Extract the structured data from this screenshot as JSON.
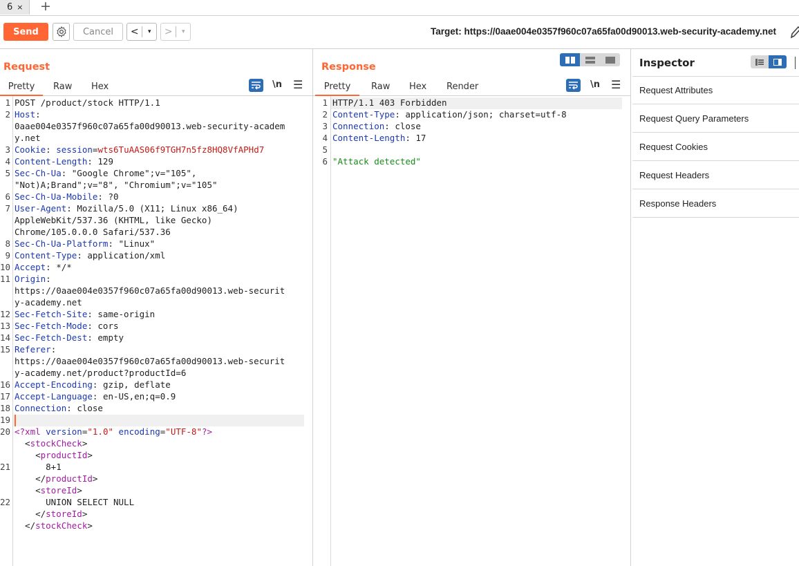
{
  "tab": {
    "label": "6",
    "close": "×",
    "new": "+"
  },
  "toolbar": {
    "send_label": "Send",
    "cancel_label": "Cancel",
    "back": "<",
    "forward": ">",
    "dropdown": "▾",
    "target_label": "Target: https://0aae004e0357f960c07a65fa00d90013.web-security-academy.net"
  },
  "request": {
    "title": "Request",
    "tabs": [
      "Pretty",
      "Raw",
      "Hex"
    ],
    "newline_label": "\\n",
    "lines": [
      {
        "n": "1",
        "segs": [
          {
            "t": "POST /product/stock HTTP/1.1",
            "c": ""
          }
        ]
      },
      {
        "n": "2",
        "segs": [
          {
            "t": "Host",
            "c": "hk"
          },
          {
            "t": ":",
            "c": ""
          }
        ]
      },
      {
        "n": "",
        "segs": [
          {
            "t": "0aae004e0357f960c07a65fa00d90013.web-security-academ",
            "c": ""
          }
        ]
      },
      {
        "n": "",
        "segs": [
          {
            "t": "y.net",
            "c": ""
          }
        ]
      },
      {
        "n": "3",
        "segs": [
          {
            "t": "Cookie",
            "c": "hk"
          },
          {
            "t": ": ",
            "c": ""
          },
          {
            "t": "session",
            "c": "hk"
          },
          {
            "t": "=",
            "c": ""
          },
          {
            "t": "wts6TuAAS06f9TGH7n5fz8HQ8VfAPHd7",
            "c": "cookie"
          }
        ]
      },
      {
        "n": "4",
        "segs": [
          {
            "t": "Content-Length",
            "c": "hk"
          },
          {
            "t": ": 129",
            "c": ""
          }
        ]
      },
      {
        "n": "5",
        "segs": [
          {
            "t": "Sec-Ch-Ua",
            "c": "hk"
          },
          {
            "t": ": \"Google Chrome\";v=\"105\",",
            "c": ""
          }
        ]
      },
      {
        "n": "",
        "segs": [
          {
            "t": "\"Not)A;Brand\";v=\"8\", \"Chromium\";v=\"105\"",
            "c": ""
          }
        ]
      },
      {
        "n": "6",
        "segs": [
          {
            "t": "Sec-Ch-Ua-Mobile",
            "c": "hk"
          },
          {
            "t": ": ?0",
            "c": ""
          }
        ]
      },
      {
        "n": "7",
        "segs": [
          {
            "t": "User-Agent",
            "c": "hk"
          },
          {
            "t": ": Mozilla/5.0 (X11; Linux x86_64)",
            "c": ""
          }
        ]
      },
      {
        "n": "",
        "segs": [
          {
            "t": "AppleWebKit/537.36 (KHTML, like Gecko)",
            "c": ""
          }
        ]
      },
      {
        "n": "",
        "segs": [
          {
            "t": "Chrome/105.0.0.0 Safari/537.36",
            "c": ""
          }
        ]
      },
      {
        "n": "8",
        "segs": [
          {
            "t": "Sec-Ch-Ua-Platform",
            "c": "hk"
          },
          {
            "t": ": \"Linux\"",
            "c": ""
          }
        ]
      },
      {
        "n": "9",
        "segs": [
          {
            "t": "Content-Type",
            "c": "hk"
          },
          {
            "t": ": application/xml",
            "c": ""
          }
        ]
      },
      {
        "n": "10",
        "segs": [
          {
            "t": "Accept",
            "c": "hk"
          },
          {
            "t": ": */*",
            "c": ""
          }
        ]
      },
      {
        "n": "11",
        "segs": [
          {
            "t": "Origin",
            "c": "hk"
          },
          {
            "t": ":",
            "c": ""
          }
        ]
      },
      {
        "n": "",
        "segs": [
          {
            "t": "https://0aae004e0357f960c07a65fa00d90013.web-securit",
            "c": ""
          }
        ]
      },
      {
        "n": "",
        "segs": [
          {
            "t": "y-academy.net",
            "c": ""
          }
        ]
      },
      {
        "n": "12",
        "segs": [
          {
            "t": "Sec-Fetch-Site",
            "c": "hk"
          },
          {
            "t": ": same-origin",
            "c": ""
          }
        ]
      },
      {
        "n": "13",
        "segs": [
          {
            "t": "Sec-Fetch-Mode",
            "c": "hk"
          },
          {
            "t": ": cors",
            "c": ""
          }
        ]
      },
      {
        "n": "14",
        "segs": [
          {
            "t": "Sec-Fetch-Dest",
            "c": "hk"
          },
          {
            "t": ": empty",
            "c": ""
          }
        ]
      },
      {
        "n": "15",
        "segs": [
          {
            "t": "Referer",
            "c": "hk"
          },
          {
            "t": ":",
            "c": ""
          }
        ]
      },
      {
        "n": "",
        "segs": [
          {
            "t": "https://0aae004e0357f960c07a65fa00d90013.web-securit",
            "c": ""
          }
        ]
      },
      {
        "n": "",
        "segs": [
          {
            "t": "y-academy.net/product?productId=6",
            "c": ""
          }
        ]
      },
      {
        "n": "16",
        "segs": [
          {
            "t": "Accept-Encoding",
            "c": "hk"
          },
          {
            "t": ": gzip, deflate",
            "c": ""
          }
        ]
      },
      {
        "n": "17",
        "segs": [
          {
            "t": "Accept-Language",
            "c": "hk"
          },
          {
            "t": ": en-US,en;q=0.9",
            "c": ""
          }
        ]
      },
      {
        "n": "18",
        "segs": [
          {
            "t": "Connection",
            "c": "hk"
          },
          {
            "t": ": close",
            "c": ""
          }
        ]
      },
      {
        "n": "19",
        "segs": [
          {
            "t": "",
            "c": ""
          }
        ]
      },
      {
        "n": "20",
        "segs": [
          {
            "t": "<?xml ",
            "c": "tag"
          },
          {
            "t": "version",
            "c": "attr"
          },
          {
            "t": "=",
            "c": ""
          },
          {
            "t": "\"1.0\"",
            "c": "str"
          },
          {
            "t": " ",
            "c": ""
          },
          {
            "t": "encoding",
            "c": "attr"
          },
          {
            "t": "=",
            "c": ""
          },
          {
            "t": "\"UTF-8\"",
            "c": "str"
          },
          {
            "t": "?>",
            "c": "tag"
          }
        ]
      },
      {
        "n": "",
        "segs": [
          {
            "t": "  <",
            "c": ""
          },
          {
            "t": "stockCheck",
            "c": "tag"
          },
          {
            "t": ">",
            "c": ""
          }
        ]
      },
      {
        "n": "",
        "segs": [
          {
            "t": "    <",
            "c": ""
          },
          {
            "t": "productId",
            "c": "tag"
          },
          {
            "t": ">",
            "c": ""
          }
        ]
      },
      {
        "n": "21",
        "segs": [
          {
            "t": "      8+1",
            "c": ""
          }
        ]
      },
      {
        "n": "",
        "segs": [
          {
            "t": "    </",
            "c": ""
          },
          {
            "t": "productId",
            "c": "tag"
          },
          {
            "t": ">",
            "c": ""
          }
        ]
      },
      {
        "n": "",
        "segs": [
          {
            "t": "    <",
            "c": ""
          },
          {
            "t": "storeId",
            "c": "tag"
          },
          {
            "t": ">",
            "c": ""
          }
        ]
      },
      {
        "n": "22",
        "segs": [
          {
            "t": "      UNION SELECT NULL",
            "c": ""
          }
        ]
      },
      {
        "n": "",
        "segs": [
          {
            "t": "    </",
            "c": ""
          },
          {
            "t": "storeId",
            "c": "tag"
          },
          {
            "t": ">",
            "c": ""
          }
        ]
      },
      {
        "n": "",
        "segs": [
          {
            "t": "  </",
            "c": ""
          },
          {
            "t": "stockCheck",
            "c": "tag"
          },
          {
            "t": ">",
            "c": ""
          }
        ]
      }
    ]
  },
  "response": {
    "title": "Response",
    "tabs": [
      "Pretty",
      "Raw",
      "Hex",
      "Render"
    ],
    "newline_label": "\\n",
    "lines": [
      {
        "n": "1",
        "segs": [
          {
            "t": "HTTP/1.1 403 Forbidden",
            "c": ""
          }
        ]
      },
      {
        "n": "2",
        "segs": [
          {
            "t": "Content-Type",
            "c": "hk"
          },
          {
            "t": ": application/json; charset=utf-8",
            "c": ""
          }
        ]
      },
      {
        "n": "3",
        "segs": [
          {
            "t": "Connection",
            "c": "hk"
          },
          {
            "t": ": close",
            "c": ""
          }
        ]
      },
      {
        "n": "4",
        "segs": [
          {
            "t": "Content-Length",
            "c": "hk"
          },
          {
            "t": ": 17",
            "c": ""
          }
        ]
      },
      {
        "n": "5",
        "segs": [
          {
            "t": "",
            "c": ""
          }
        ]
      },
      {
        "n": "6",
        "segs": [
          {
            "t": "\"Attack detected\"",
            "c": "json"
          }
        ]
      }
    ]
  },
  "inspector": {
    "title": "Inspector",
    "items": [
      "Request Attributes",
      "Request Query Parameters",
      "Request Cookies",
      "Request Headers",
      "Response Headers"
    ]
  },
  "colors": {
    "accent": "#ff6633",
    "blue": "#2c6db5"
  }
}
